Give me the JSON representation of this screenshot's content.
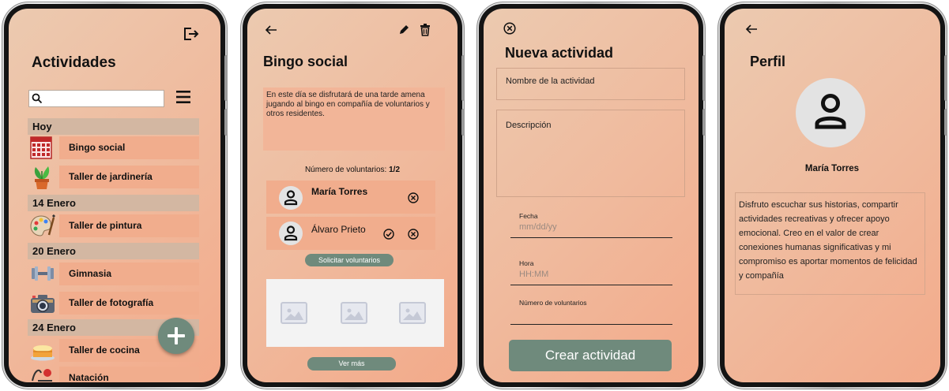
{
  "screens": {
    "activities": {
      "title": "Actividades",
      "search": {
        "placeholder": "",
        "value": ""
      },
      "icons": {
        "logout": "logout-icon",
        "search": "search-icon",
        "menu": "hamburger-menu-icon",
        "add": "plus-icon"
      },
      "sections": [
        {
          "header": "Hoy",
          "items": [
            {
              "label": "Bingo social",
              "icon": "bingo-card-icon"
            },
            {
              "label": "Taller de jardinería",
              "icon": "potted-plant-icon"
            }
          ]
        },
        {
          "header": "14 Enero",
          "items": [
            {
              "label": "Taller de pintura",
              "icon": "paint-palette-icon"
            }
          ]
        },
        {
          "header": "20 Enero",
          "items": [
            {
              "label": "Gimnasia",
              "icon": "dumbbell-icon"
            },
            {
              "label": "Taller de fotografía",
              "icon": "camera-icon"
            }
          ]
        },
        {
          "header": "24 Enero",
          "items": [
            {
              "label": "Taller de cocina",
              "icon": "cake-icon"
            },
            {
              "label": "Natación",
              "icon": "swimmer-icon"
            }
          ]
        }
      ]
    },
    "activity_detail": {
      "title": "Bingo social",
      "description": "En este día se disfrutará de una tarde amena jugando al bingo en compañía de voluntarios y otros residentes.",
      "volunteers_label": "Número de voluntarios: ",
      "volunteers_count": "1/2",
      "volunteers": [
        {
          "name": "María Torres",
          "actions": [
            "remove"
          ]
        },
        {
          "name": "Álvaro Prieto",
          "actions": [
            "approve",
            "remove"
          ]
        }
      ],
      "request_button": "Solicitar voluntarios",
      "more_button": "Ver más",
      "gallery_count": 3
    },
    "new_activity": {
      "title": "Nueva actividad",
      "name_placeholder": "Nombre de la actividad",
      "description_placeholder": "Descripción",
      "date_label": "Fecha",
      "date_placeholder": "mm/dd/yy",
      "time_label": "Hora",
      "time_placeholder": "HH:MM",
      "volunteers_label": "Número de voluntarios",
      "create_button": "Crear actividad"
    },
    "profile": {
      "title": "Perfil",
      "name": "María Torres",
      "bio": "Disfruto escuchar sus historias, compartir actividades recreativas y ofrecer apoyo emocional. Creo en el valor de crear conexiones humanas significativas y mi compromiso es aportar momentos de felicidad y compañía"
    }
  },
  "colors": {
    "accent_green": "#6f8a7c",
    "row_fill": "#f1ad8d",
    "section_header": "#d3b7a2",
    "gradient_start": "#eccab0",
    "gradient_end": "#f3aa8a"
  }
}
